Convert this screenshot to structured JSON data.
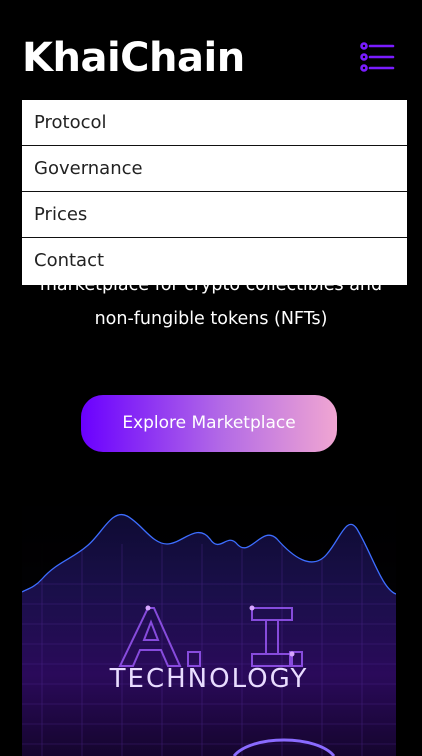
{
  "header": {
    "brand": "KhaiChain",
    "menu_icon": "hamburger-list-icon",
    "menu_icon_color": "#7a1cff"
  },
  "nav_menu": {
    "items": [
      "Protocol",
      "Governance",
      "Prices",
      "Contact"
    ]
  },
  "hero": {
    "description": "marketplace for crypto collectibles and non-fungible tokens (NFTs)",
    "cta_label": "Explore Marketplace",
    "cta_gradient": [
      "#6a00ff",
      "#f0a6d2"
    ]
  },
  "banner": {
    "headline": "A.I.",
    "subtitle": "TECHNOLOGY"
  }
}
